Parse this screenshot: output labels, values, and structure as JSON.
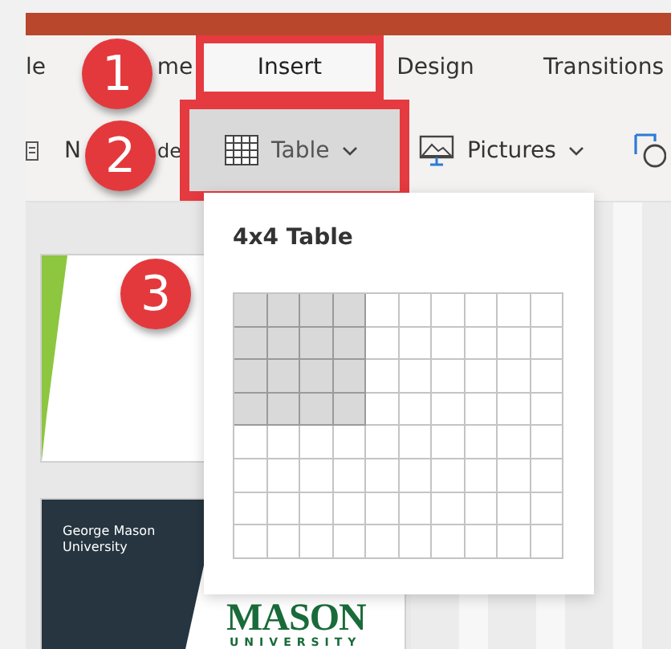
{
  "tabs": [
    {
      "label": "le",
      "selected": false
    },
    {
      "label": "me",
      "selected": false
    },
    {
      "label": "Insert",
      "selected": true
    },
    {
      "label": "Design",
      "selected": false
    },
    {
      "label": "Transitions",
      "selected": false
    }
  ],
  "toolbar": [
    {
      "kind": "slide-part",
      "label": "N"
    },
    {
      "kind": "text",
      "label": "de"
    },
    {
      "kind": "table",
      "label": "Table",
      "highlighted": true
    },
    {
      "kind": "pictures",
      "label": "Pictures"
    },
    {
      "kind": "shapes"
    }
  ],
  "table_picker": {
    "title": "4x4 Table",
    "rows": [
      {
        "cells": [
          {
            "selected": true
          },
          {
            "selected": true
          },
          {
            "selected": true
          },
          {
            "selected": true
          },
          {
            "selected": false
          },
          {
            "selected": false
          },
          {
            "selected": false
          },
          {
            "selected": false
          },
          {
            "selected": false
          },
          {
            "selected": false
          }
        ]
      },
      {
        "cells": [
          {
            "selected": true
          },
          {
            "selected": true
          },
          {
            "selected": true
          },
          {
            "selected": true
          },
          {
            "selected": false
          },
          {
            "selected": false
          },
          {
            "selected": false
          },
          {
            "selected": false
          },
          {
            "selected": false
          },
          {
            "selected": false
          }
        ]
      },
      {
        "cells": [
          {
            "selected": true
          },
          {
            "selected": true
          },
          {
            "selected": true
          },
          {
            "selected": true
          },
          {
            "selected": false
          },
          {
            "selected": false
          },
          {
            "selected": false
          },
          {
            "selected": false
          },
          {
            "selected": false
          },
          {
            "selected": false
          }
        ]
      },
      {
        "cells": [
          {
            "selected": true
          },
          {
            "selected": true
          },
          {
            "selected": true
          },
          {
            "selected": true
          },
          {
            "selected": false
          },
          {
            "selected": false
          },
          {
            "selected": false
          },
          {
            "selected": false
          },
          {
            "selected": false
          },
          {
            "selected": false
          }
        ]
      },
      {
        "cells": [
          {
            "selected": false
          },
          {
            "selected": false
          },
          {
            "selected": false
          },
          {
            "selected": false
          },
          {
            "selected": false
          },
          {
            "selected": false
          },
          {
            "selected": false
          },
          {
            "selected": false
          },
          {
            "selected": false
          },
          {
            "selected": false
          }
        ]
      },
      {
        "cells": [
          {
            "selected": false
          },
          {
            "selected": false
          },
          {
            "selected": false
          },
          {
            "selected": false
          },
          {
            "selected": false
          },
          {
            "selected": false
          },
          {
            "selected": false
          },
          {
            "selected": false
          },
          {
            "selected": false
          },
          {
            "selected": false
          }
        ]
      },
      {
        "cells": [
          {
            "selected": false
          },
          {
            "selected": false
          },
          {
            "selected": false
          },
          {
            "selected": false
          },
          {
            "selected": false
          },
          {
            "selected": false
          },
          {
            "selected": false
          },
          {
            "selected": false
          },
          {
            "selected": false
          },
          {
            "selected": false
          }
        ]
      },
      {
        "cells": [
          {
            "selected": false
          },
          {
            "selected": false
          },
          {
            "selected": false
          },
          {
            "selected": false
          },
          {
            "selected": false
          },
          {
            "selected": false
          },
          {
            "selected": false
          },
          {
            "selected": false
          },
          {
            "selected": false
          },
          {
            "selected": false
          }
        ]
      }
    ]
  },
  "slides": [
    {
      "kind": "light"
    },
    {
      "kind": "dark",
      "caption": "George Mason University",
      "logo": "MASON",
      "logo_subtitle": "UNIVERSITY"
    }
  ],
  "callouts": [
    {
      "label": "1"
    },
    {
      "label": "2"
    },
    {
      "label": "3"
    }
  ]
}
